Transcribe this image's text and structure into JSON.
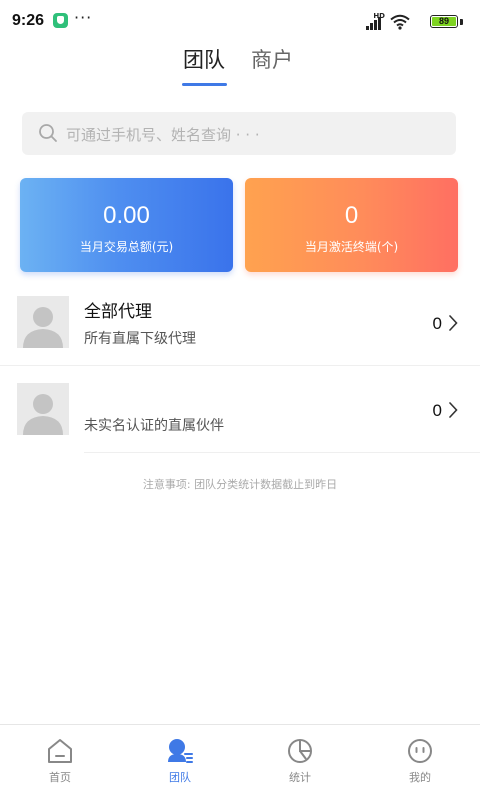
{
  "status_bar": {
    "time": "9:26",
    "dots": "···",
    "network": "HD",
    "battery": "89"
  },
  "tabs": [
    {
      "label": "团队",
      "active": true
    },
    {
      "label": "商户",
      "active": false
    }
  ],
  "search": {
    "placeholder": "可通过手机号、姓名查询 · · ·"
  },
  "stats": [
    {
      "value": "0.00",
      "label": "当月交易总额(元)",
      "color": "#4f8ff0"
    },
    {
      "value": "0",
      "label": "当月激活终端(个)",
      "color": "#ff8c5a"
    }
  ],
  "list": [
    {
      "title": "全部代理",
      "subtitle": "所有直属下级代理",
      "count": "0"
    },
    {
      "title": "",
      "subtitle": "未实名认证的直属伙伴",
      "count": "0"
    }
  ],
  "note": "注意事项: 团队分类统计数据截止到昨日",
  "bottom_nav": [
    {
      "label": "首页",
      "icon": "home-icon",
      "active": false
    },
    {
      "label": "团队",
      "icon": "team-icon",
      "active": true
    },
    {
      "label": "统计",
      "icon": "pie-chart-icon",
      "active": false
    },
    {
      "label": "我的",
      "icon": "profile-icon",
      "active": false
    }
  ],
  "colors": {
    "accent": "#3f79e6",
    "battery": "#7ed321"
  }
}
